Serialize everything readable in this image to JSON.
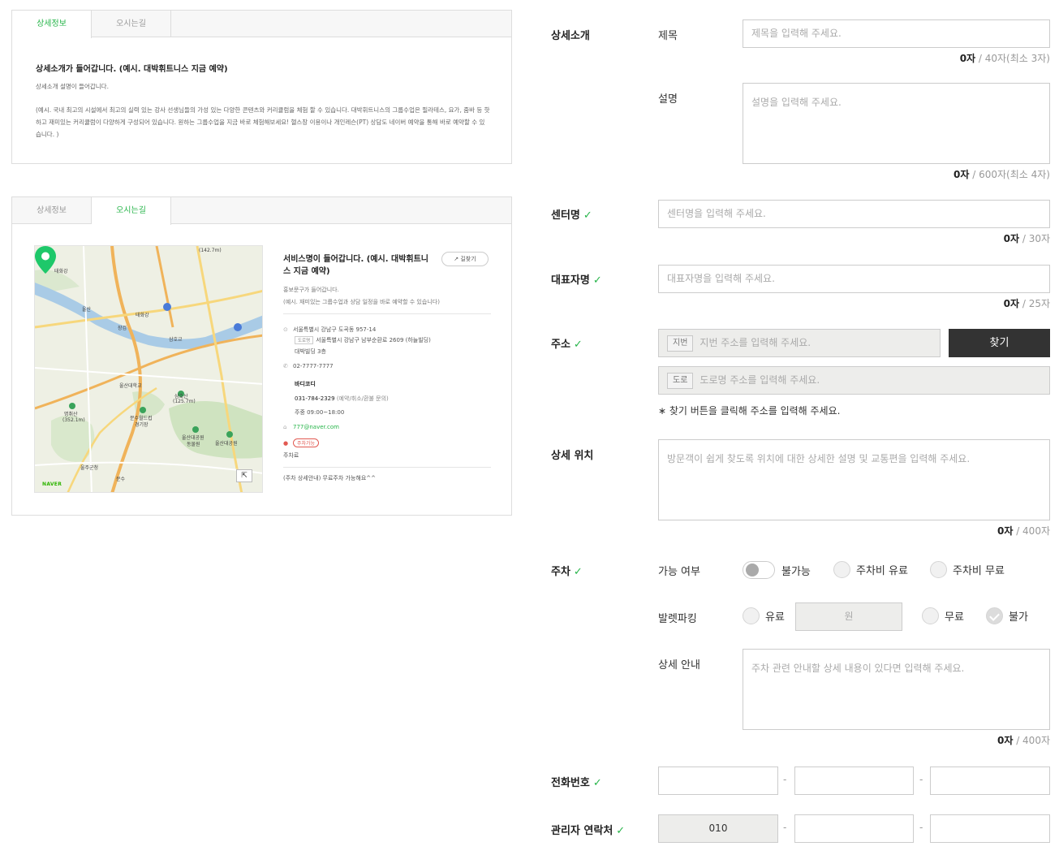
{
  "preview": {
    "tab_detail": "상세정보",
    "tab_directions": "오시는길",
    "detail_title": "상세소개가 들어갑니다. (예시. 대박휘트니스 지금 예약)",
    "detail_subtitle": "상세소개 설명이 들어갑니다.",
    "detail_body": "(예시. 국내 최고의 시설에서 최고의 실력 있는 강사 선생님들의 가성 있는 다양한 콘텐츠와 커리큘럼을 체험 할 수 있습니다. 대박휘트니스의 그룹수업은 필라테스, 요가, 줌바 등 핫하고 재미있는 커리큘럼이 다양하게 구성되어 있습니다. 원하는 그룹수업을 지금 바로 체험해보세요! 헬스장 이용이나 개인레슨(PT) 상담도 네이버 예약을 통해 바로 예약할 수 있습니다. )",
    "map": {
      "labels": {
        "l1": "(142.7m)",
        "l2": "태화강",
        "l3": "울산",
        "l4": "태화강",
        "l5": "장검",
        "l6": "울산대학교",
        "l7": "삼호산",
        "l8": "(125.7m)",
        "l9": "명취산",
        "l10": "(352.1m)",
        "l11": "문수월드컵",
        "l12": "경기장",
        "l13": "울산대공원",
        "l14": "동물원",
        "l15": "울산대공원",
        "l16": "울주군청",
        "l17": "문수",
        "l18": "삼호교"
      },
      "logo": "NAVER",
      "zoom_icon": "⇱"
    },
    "info": {
      "title": "서비스명이 들어갑니다. (예시. 대박휘트니스 지금 예약)",
      "directions_button": "↗ 길찾기",
      "promo": "홍보문구가 들어갑니다.",
      "promo_example": "(예시. 재미있는 그룹수업과 상담 일정을 바로 예약할 수 있습니다)",
      "address": "서울특별시 강남구 도곡동 957-14",
      "road_tag": "도로명",
      "road_address": "서울특별시 강남구 남부순환로 2609 (하늘빌딩)",
      "building": "대박빌딩 3층",
      "phone": "02-7777-7777",
      "contact_name": "바디코디",
      "contact_phone": "031-784-2329",
      "contact_note": "(예약/취소/환불 문의)",
      "hours": "주중  09:00~18:00",
      "email": "777@naver.com",
      "parking_badge": "주차가능",
      "parking_label": "주차료",
      "parking_note": "(주차 상세안내) 무료주차 가능해요^^"
    }
  },
  "form": {
    "sections": {
      "intro": "상세소개",
      "center": "센터명",
      "rep": "대표자명",
      "address": "주소",
      "location": "상세 위치",
      "parking": "주차",
      "phone": "전화번호",
      "manager": "관리자 연락처"
    },
    "check_mark": "✓",
    "title_label": "제목",
    "title_placeholder": "제목을 입력해 주세요.",
    "title_count": "0자",
    "title_limit": " / 40자(최소 3자)",
    "desc_label": "설명",
    "desc_placeholder": "설명을 입력해 주세요.",
    "desc_count": "0자",
    "desc_limit": " / 600자(최소 4자)",
    "center_placeholder": "센터명을 입력해 주세요.",
    "center_count": "0자",
    "center_limit": " / 30자",
    "rep_placeholder": "대표자명을 입력해 주세요.",
    "rep_count": "0자",
    "rep_limit": " / 25자",
    "jibun_prefix": "지번",
    "jibun_placeholder": "지번 주소를 입력해 주세요.",
    "find_button": "찾기",
    "road_prefix": "도로",
    "road_placeholder": "도로명 주소를 입력해 주세요.",
    "address_hint": "∗ 찾기 버튼을 클릭해 주소를 입력해 주세요.",
    "location_placeholder": "방문객이 쉽게 찾도록 위치에 대한 상세한 설명 및 교통편을 입력해 주세요.",
    "location_count": "0자",
    "location_limit": " / 400자",
    "parking_avail_label": "가능 여부",
    "parking_unavailable": "불가능",
    "parking_paid": "주차비 유료",
    "parking_free": "주차비 무료",
    "valet_label": "발렛파킹",
    "valet_paid": "유료",
    "valet_price_placeholder": "원",
    "valet_free": "무료",
    "valet_none": "불가",
    "parking_detail_label": "상세 안내",
    "parking_detail_placeholder": "주차 관련 안내할 상세 내용이 있다면 입력해 주세요.",
    "parking_count": "0자",
    "parking_limit": " / 400자",
    "phone_dash": "-",
    "manager_prefix": "010"
  }
}
